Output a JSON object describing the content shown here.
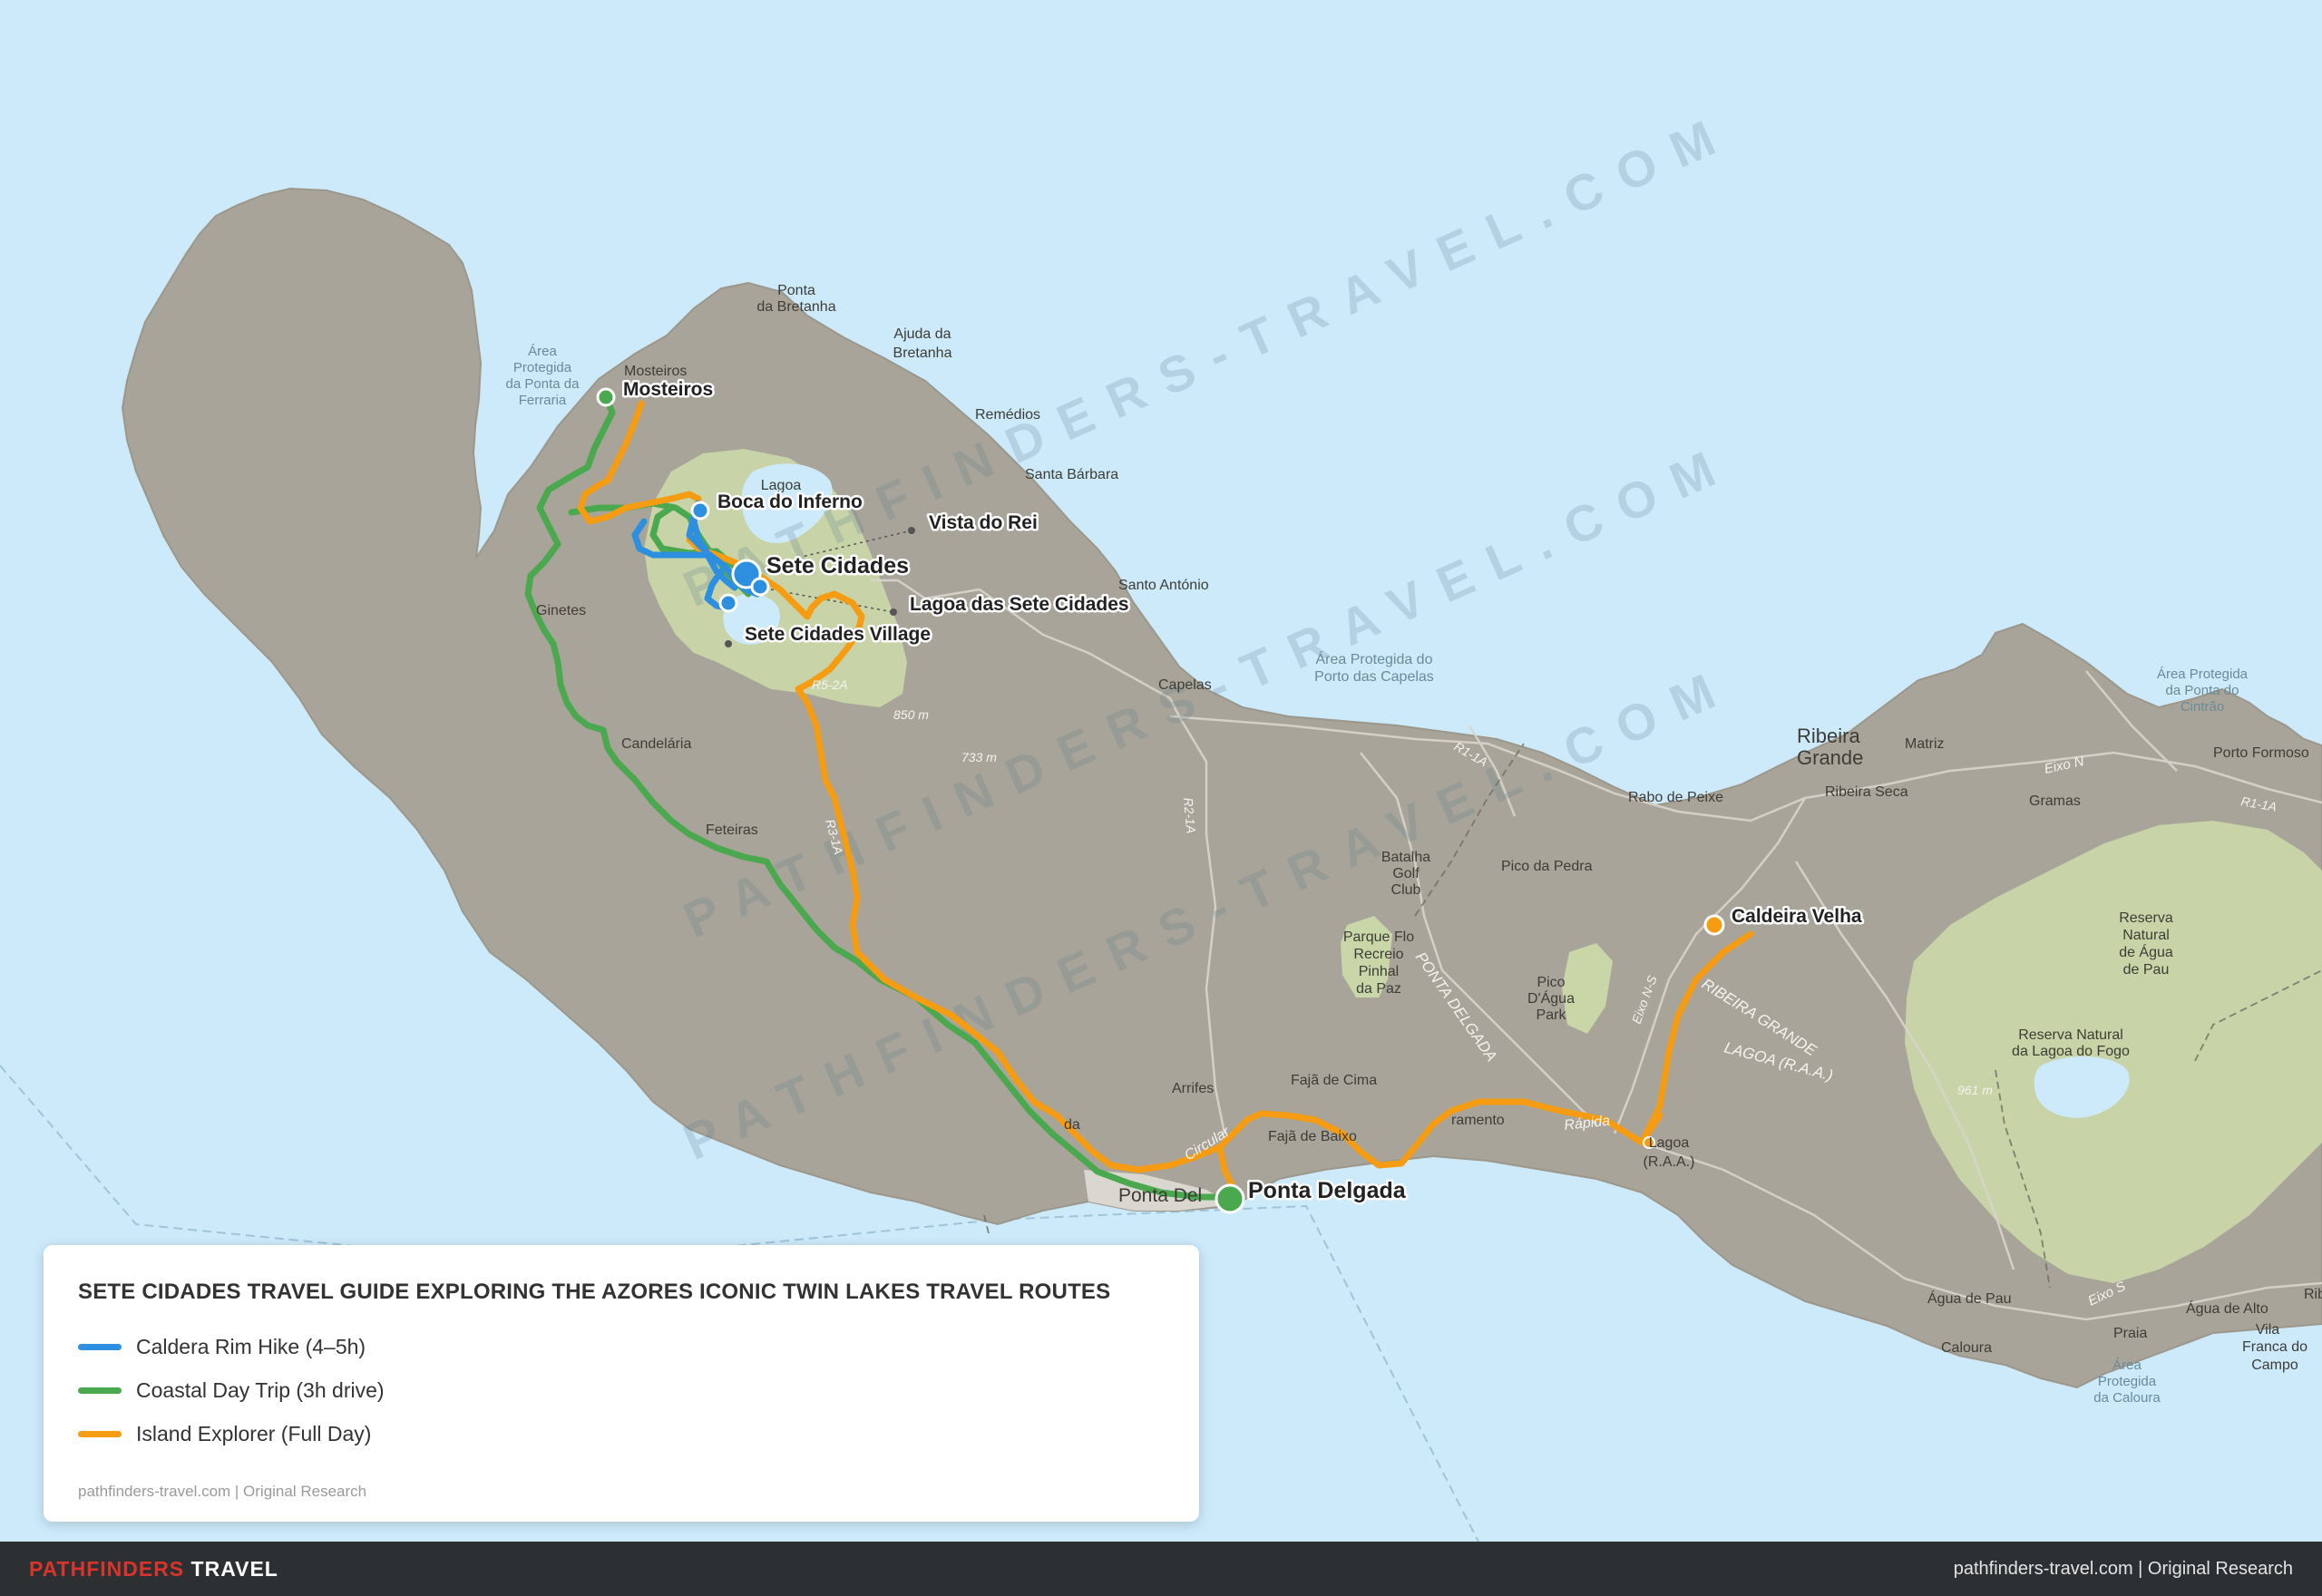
{
  "legend": {
    "title": "SETE CIDADES TRAVEL GUIDE EXPLORING THE AZORES ICONIC TWIN LAKES TRAVEL ROUTES",
    "routes": [
      {
        "label": "Caldera Rim Hike (4–5h)",
        "color": "#2d8fe0"
      },
      {
        "label": "Coastal Day Trip (3h drive)",
        "color": "#4aa84e"
      },
      {
        "label": "Island Explorer (Full Day)",
        "color": "#f59c12"
      }
    ],
    "source": "pathfinders-travel.com | Original Research"
  },
  "footer": {
    "brand_part1": "PATHFINDERS",
    "brand_part2": "TRAVEL",
    "right": "pathfinders-travel.com  |  Original Research"
  },
  "watermark": "PATHFINDERS-TRAVEL.COM",
  "destinations": {
    "mosteiros": "Mosteiros",
    "boca_do_inferno": "Boca do Inferno",
    "vista_do_rei": "Vista do Rei",
    "sete_cidades": "Sete Cidades",
    "lagoa_sete_cidades": "Lagoa das Sete Cidades",
    "sete_cidades_village": "Sete Cidades Village",
    "ponta_delgada": "Ponta Delgada",
    "caldeira_velha": "Caldeira Velha"
  },
  "places": {
    "ponta_da_bretanha_1": "Ponta",
    "ponta_da_bretanha_2": "da Bretanha",
    "ajuda_1": "Ajuda da",
    "ajuda_2": "Bretanha",
    "remedios": "Remédios",
    "santa_barbara": "Santa Bárbara",
    "santo_antonio": "Santo António",
    "capelas": "Capelas",
    "area_capelas_1": "Área Protegida do",
    "area_capelas_2": "Porto das Capelas",
    "ginetes": "Ginetes",
    "candelaria": "Candelária",
    "feteiras": "Feteiras",
    "arrifes": "Arrifes",
    "faja_de_cima": "Fajã de Cima",
    "faja_de_baixo": "Fajã de Baixo",
    "ponta_delgada_small": "Ponta Del",
    "ribeira_grande_1": "Ribeira",
    "ribeira_grande_2": "Grande",
    "matriz": "Matriz",
    "rabo_de_peixe": "Rabo de Peixe",
    "ribeira_seca": "Ribeira Seca",
    "gramas": "Gramas",
    "eixo_n": "Eixo N",
    "porto_formoso": "Porto Formoso",
    "area_cintrao_1": "Área Protegida",
    "area_cintrao_2": "da Ponta do",
    "area_cintrao_3": "Cintrão",
    "pico_da_pedra": "Pico da Pedra",
    "batalha_1": "Batalha",
    "batalha_2": "Golf",
    "batalha_3": "Club",
    "parque_1": "Parque Flo",
    "parque_2": "Recreio",
    "parque_3": "Pinhal",
    "parque_4": "da Paz",
    "pico_agua_1": "Pico",
    "pico_agua_2": "D'Água",
    "pico_agua_3": "Park",
    "reserva_agua_1": "Reserva",
    "reserva_agua_2": "Natural",
    "reserva_agua_3": "de Água",
    "reserva_agua_4": "de Pau",
    "reserva_fogo_1": "Reserva Natural",
    "reserva_fogo_2": "da Lagoa do Fogo",
    "lagoa_1": "Lagoa",
    "lagoa_2": "(R.A.A.)",
    "agua_de_pau": "Água de Pau",
    "caloura": "Caloura",
    "praia": "Praia",
    "agua_de_alto": "Água de Alto",
    "vila_franca_1": "Vila",
    "vila_franca_2": "Franca do",
    "vila_franca_3": "Campo",
    "area_caloura_1": "Área",
    "area_caloura_2": "Protegida",
    "area_caloura_3": "da Caloura",
    "area_ferraria_1": "Área",
    "area_ferraria_2": "Protegida",
    "area_ferraria_3": "da Ponta da",
    "area_ferraria_4": "Ferraria",
    "mosteiros_small": "Mosteiros",
    "lagoa_small": "Lagoa",
    "eixo_s": "Eixo S",
    "ribeira_edge": "Rib",
    "ramento": "ramento",
    "rapida": "Rápida",
    "circular": "Circular",
    "da_edge": "da",
    "lagoa_raa": "LAGOA (R.A.A.)",
    "ponta_delgada_road": "PONTA DELGADA",
    "ribeira_grande_road": "RIBEIRA GRANDE",
    "r1_1a": "R1-1A",
    "r1_1a_b": "R1-1A",
    "r2_1a": "R2-1A",
    "r3_1a": "R3-1A",
    "eixo_ns": "Eixo N-S",
    "r5_2a": "R5-2A",
    "elev_850": "850 m",
    "elev_733": "733 m",
    "elev_961": "961 m"
  }
}
